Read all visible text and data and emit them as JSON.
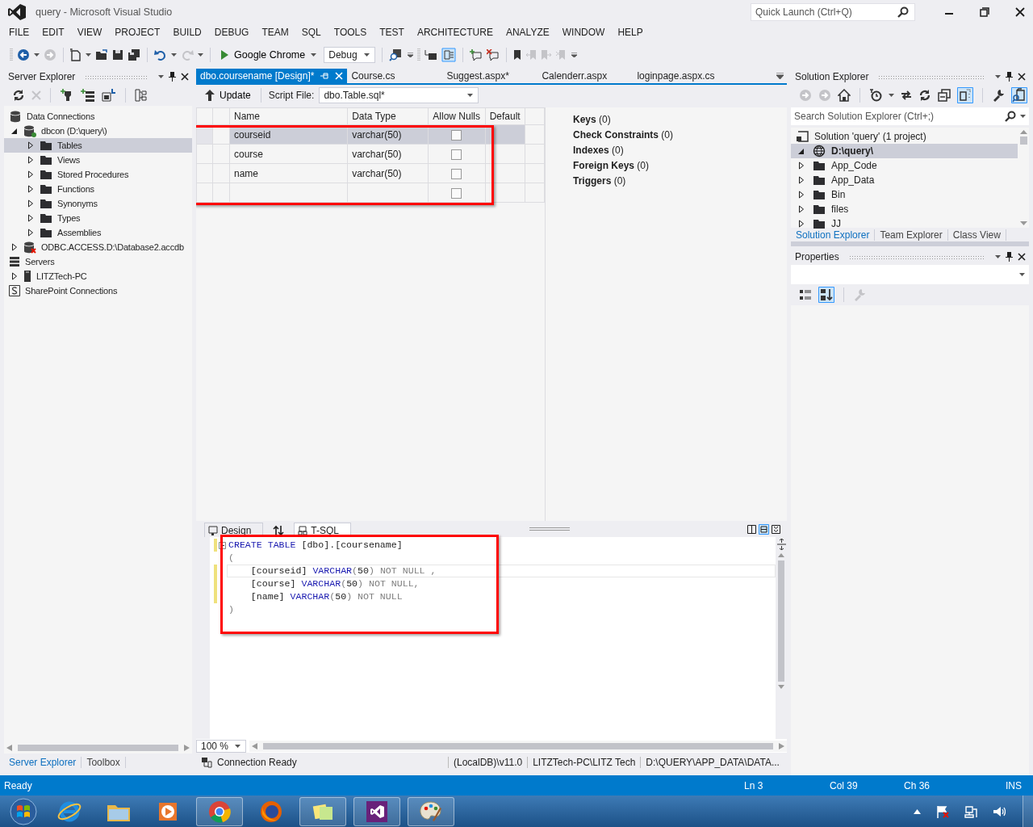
{
  "window": {
    "title": "query - Microsoft Visual Studio",
    "quick_launch": {
      "placeholder": "Quick Launch (Ctrl+Q)"
    }
  },
  "menu": [
    "FILE",
    "EDIT",
    "VIEW",
    "PROJECT",
    "BUILD",
    "DEBUG",
    "TEAM",
    "SQL",
    "TOOLS",
    "TEST",
    "ARCHITECTURE",
    "ANALYZE",
    "WINDOW",
    "HELP"
  ],
  "toolbar": {
    "run_target": "Google Chrome",
    "configuration": "Debug"
  },
  "server_explorer": {
    "title": "Server Explorer",
    "tree": [
      {
        "label": "Data Connections",
        "kind": "connections",
        "selected": false,
        "children": [
          {
            "label": "dbcon (D:\\query\\)",
            "kind": "db-ok",
            "expanded": true,
            "selected": false,
            "children": [
              {
                "label": "Tables",
                "kind": "folder",
                "expanded": false,
                "selected": true
              },
              {
                "label": "Views",
                "kind": "folder",
                "expanded": false,
                "selected": false
              },
              {
                "label": "Stored Procedures",
                "kind": "folder",
                "expanded": false,
                "selected": false
              },
              {
                "label": "Functions",
                "kind": "folder",
                "expanded": false,
                "selected": false
              },
              {
                "label": "Synonyms",
                "kind": "folder",
                "expanded": false,
                "selected": false
              },
              {
                "label": "Types",
                "kind": "folder",
                "expanded": false,
                "selected": false
              },
              {
                "label": "Assemblies",
                "kind": "folder",
                "expanded": false,
                "selected": false
              }
            ]
          },
          {
            "label": "ODBC.ACCESS.D:\\Database2.accdb",
            "kind": "db-error",
            "expanded": false,
            "selected": false
          }
        ]
      },
      {
        "label": "Servers",
        "kind": "servers",
        "selected": false,
        "children": [
          {
            "label": "LITZTech-PC",
            "kind": "computer",
            "expanded": false,
            "selected": false
          }
        ]
      },
      {
        "label": "SharePoint Connections",
        "kind": "sharepoint",
        "selected": false
      }
    ],
    "bottom_tabs": [
      {
        "label": "Server Explorer",
        "selected": true
      },
      {
        "label": "Toolbox",
        "selected": false
      }
    ]
  },
  "document_tabs": [
    {
      "label": "dbo.coursename [Design]*",
      "selected": true
    },
    {
      "label": "Course.cs",
      "selected": false
    },
    {
      "label": "Suggest.aspx*",
      "selected": false
    },
    {
      "label": "Calenderr.aspx",
      "selected": false
    },
    {
      "label": "loginpage.aspx.cs",
      "selected": false
    }
  ],
  "designer": {
    "update_label": "Update",
    "script_file_label": "Script File:",
    "script_file": "dbo.Table.sql*",
    "grid": {
      "highlighted": true,
      "columns": [
        "Name",
        "Data Type",
        "Allow Nulls",
        "Default"
      ],
      "rows": [
        {
          "name": "courseid",
          "data_type": "varchar(50)",
          "allow_nulls": false,
          "selected": true
        },
        {
          "name": "course",
          "data_type": "varchar(50)",
          "allow_nulls": false,
          "selected": false
        },
        {
          "name": "name",
          "data_type": "varchar(50)",
          "allow_nulls": false,
          "selected": false
        }
      ],
      "new_row": {
        "allow_nulls": false
      }
    },
    "properties": [
      {
        "label": "Keys",
        "count": "(0)"
      },
      {
        "label": "Check Constraints",
        "count": "(0)"
      },
      {
        "label": "Indexes",
        "count": "(0)"
      },
      {
        "label": "Foreign Keys",
        "count": "(0)"
      },
      {
        "label": "Triggers",
        "count": "(0)"
      }
    ],
    "pane_tabs": [
      {
        "label": "Design",
        "kind": "design",
        "selected": false
      },
      {
        "label": "T-SQL",
        "kind": "tsql",
        "selected": true
      }
    ],
    "editor": {
      "highlighted": true,
      "lines": [
        {
          "changed": true,
          "current": false,
          "tokens": [
            {
              "kind": "keyword",
              "text": "CREATE TABLE"
            },
            {
              "kind": "plain",
              "text": " [dbo].[coursename]"
            }
          ]
        },
        {
          "changed": false,
          "current": false,
          "tokens": [
            {
              "kind": "muted",
              "text": "("
            }
          ]
        },
        {
          "changed": true,
          "current": true,
          "tokens": [
            {
              "kind": "plain",
              "text": "    [courseid] "
            },
            {
              "kind": "keyword",
              "text": "VARCHAR"
            },
            {
              "kind": "muted",
              "text": "("
            },
            {
              "kind": "plain",
              "text": "50"
            },
            {
              "kind": "muted",
              "text": ") NOT NULL ,"
            }
          ]
        },
        {
          "changed": true,
          "current": false,
          "tokens": [
            {
              "kind": "plain",
              "text": "    [course] "
            },
            {
              "kind": "keyword",
              "text": "VARCHAR"
            },
            {
              "kind": "muted",
              "text": "("
            },
            {
              "kind": "plain",
              "text": "50"
            },
            {
              "kind": "muted",
              "text": ") NOT NULL,"
            }
          ]
        },
        {
          "changed": true,
          "current": false,
          "tokens": [
            {
              "kind": "plain",
              "text": "    [name] "
            },
            {
              "kind": "keyword",
              "text": "VARCHAR"
            },
            {
              "kind": "muted",
              "text": "("
            },
            {
              "kind": "plain",
              "text": "50"
            },
            {
              "kind": "muted",
              "text": ") NOT NULL"
            }
          ]
        },
        {
          "changed": false,
          "current": false,
          "tokens": [
            {
              "kind": "muted",
              "text": ")"
            }
          ]
        }
      ]
    },
    "zoom": "100 %",
    "connection_status": [
      "Connection Ready",
      "(LocalDB)\\v11.0",
      "LITZTech-PC\\LITZ Tech",
      "D:\\QUERY\\APP_DATA\\DATA..."
    ]
  },
  "solution_explorer": {
    "title": "Solution Explorer",
    "search": {
      "placeholder": "Search Solution Explorer (Ctrl+;)"
    },
    "tree": [
      {
        "label": "Solution 'query' (1 project)",
        "kind": "solution",
        "selected": false
      },
      {
        "label": "D:\\query\\",
        "kind": "website",
        "expanded": true,
        "selected": true,
        "children": [
          {
            "label": "App_Code",
            "kind": "folder",
            "expanded": false,
            "selected": false
          },
          {
            "label": "App_Data",
            "kind": "folder",
            "expanded": false,
            "selected": false
          },
          {
            "label": "Bin",
            "kind": "folder",
            "expanded": false,
            "selected": false
          },
          {
            "label": "files",
            "kind": "folder",
            "expanded": false,
            "selected": false
          },
          {
            "label": "JJ",
            "kind": "folder",
            "expanded": false,
            "selected": false
          }
        ]
      }
    ],
    "bottom_tabs": [
      {
        "label": "Solution Explorer",
        "selected": true
      },
      {
        "label": "Team Explorer",
        "selected": false
      },
      {
        "label": "Class View",
        "selected": false
      }
    ]
  },
  "properties_panel": {
    "title": "Properties"
  },
  "status_bar": {
    "message": "Ready",
    "line": "Ln 3",
    "column": "Col 39",
    "char": "Ch 36",
    "mode": "INS"
  },
  "taskbar": [
    {
      "kind": "start",
      "running": false
    },
    {
      "kind": "ie",
      "running": false
    },
    {
      "kind": "explorer",
      "running": false
    },
    {
      "kind": "media",
      "running": false
    },
    {
      "kind": "chrome",
      "running": true
    },
    {
      "kind": "firefox",
      "running": false
    },
    {
      "kind": "notes",
      "running": true
    },
    {
      "kind": "vs",
      "running": true
    },
    {
      "kind": "paint",
      "running": true
    }
  ]
}
